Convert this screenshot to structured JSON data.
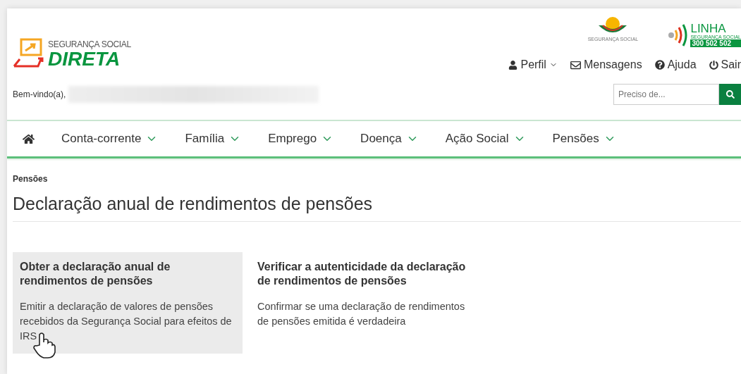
{
  "header": {
    "logo": {
      "top": "SEGURANÇA SOCIAL",
      "main": "DIRETA"
    },
    "emblem_caption": "SEGURANÇA SOCIAL",
    "hotline": {
      "title": "LINHA",
      "subtitle": "SEGURANÇA SOCIAL",
      "number": "300 502 502"
    },
    "user_menu": [
      {
        "kind": "profile",
        "label": "Perfil"
      },
      {
        "kind": "messages",
        "label": "Mensagens"
      },
      {
        "kind": "help",
        "label": "Ajuda"
      },
      {
        "kind": "logout",
        "label": "Sair"
      }
    ],
    "welcome": "Bem-vindo(a),",
    "search": {
      "placeholder": "Preciso de..."
    }
  },
  "nav": [
    {
      "label": "Conta-corrente"
    },
    {
      "label": "Família"
    },
    {
      "label": "Emprego"
    },
    {
      "label": "Doença"
    },
    {
      "label": "Ação Social"
    },
    {
      "label": "Pensões"
    }
  ],
  "breadcrumb": "Pensões",
  "title": "Declaração anual de rendimentos de pensões",
  "cards": [
    {
      "title": "Obter a declaração anual de rendimentos de pensões",
      "text": "Emitir a declaração de valores de pensões recebidos da Segurança Social para efeitos de IRS",
      "hovered": true
    },
    {
      "title": "Verificar a autenticidade da declaração de rendimentos de pensões",
      "text": "Confirmar se uma declaração de rendimentos de pensões emitida é verdadeira",
      "hovered": false
    }
  ]
}
